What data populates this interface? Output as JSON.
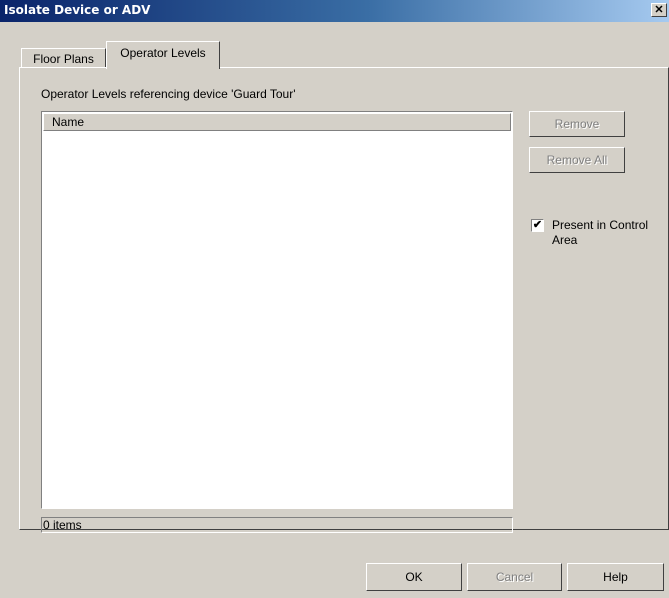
{
  "window": {
    "title": "Isolate Device or ADV",
    "close_glyph": "✕"
  },
  "tabs": [
    {
      "label": "Floor Plans",
      "active": false
    },
    {
      "label": "Operator Levels",
      "active": true
    }
  ],
  "panel": {
    "caption": "Operator Levels referencing device 'Guard Tour'",
    "list": {
      "columns": [
        "Name"
      ],
      "rows": []
    },
    "status": "0 items",
    "buttons": {
      "remove": "Remove",
      "remove_all": "Remove All"
    },
    "checkbox": {
      "label": "Present in Control Area",
      "checked": true,
      "check_glyph": "✔"
    }
  },
  "footer": {
    "ok": "OK",
    "cancel": "Cancel",
    "help": "Help"
  },
  "colors": {
    "dialog_face": "#d4d0c8",
    "title_start": "#0a246a",
    "title_end": "#a6caf0",
    "disabled_text": "#808080"
  }
}
